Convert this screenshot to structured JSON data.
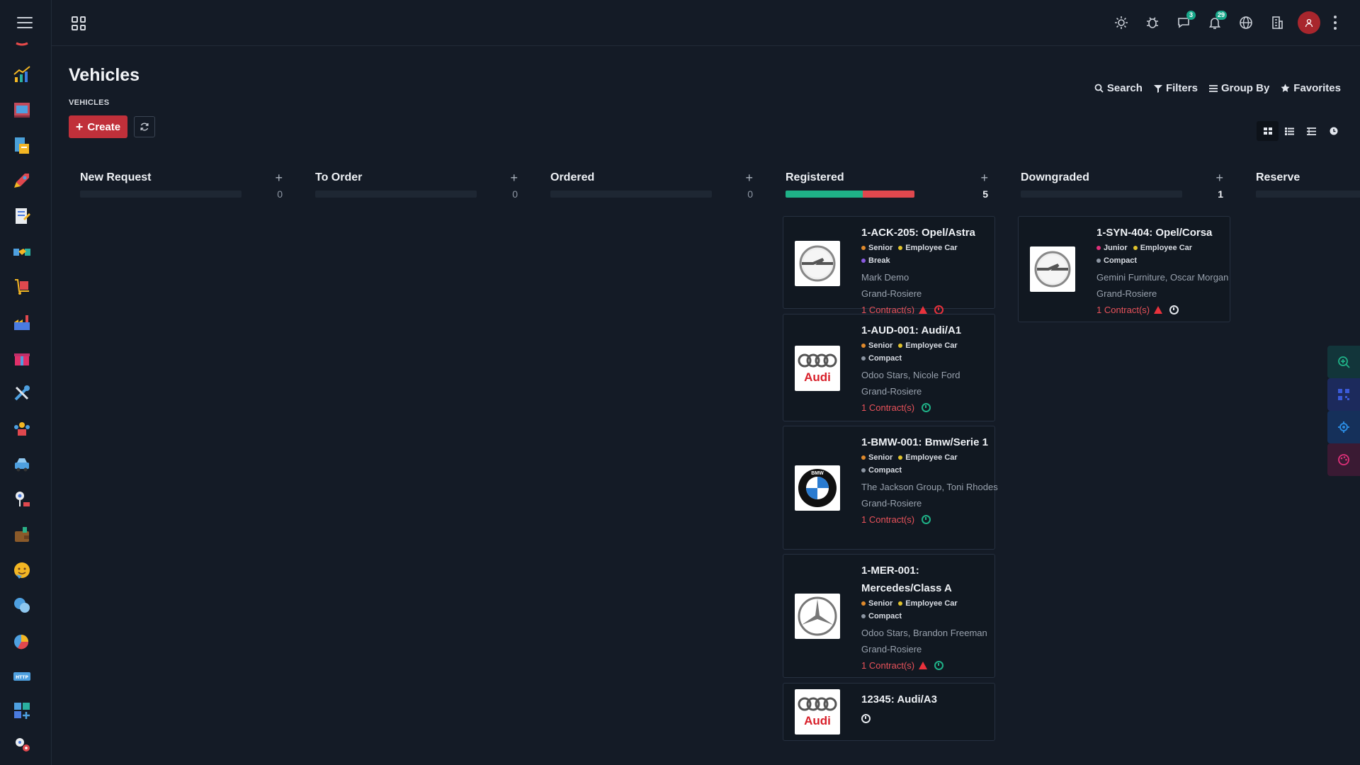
{
  "colors": {
    "background": "#141b26",
    "accent_red": "#c0303a",
    "green": "#1fb187",
    "red": "#e0484e",
    "tag_senior": "#e08a2c",
    "tag_employee_car": "#e0c22c",
    "tag_break": "#8a5ae0",
    "tag_compact": "#8d96a3",
    "tag_junior": "#e0307a"
  },
  "topbar": {
    "icons": [
      "apps-grid-icon",
      "sun-icon",
      "bug-icon",
      "chat-icon",
      "bell-icon",
      "globe-icon",
      "building-icon",
      "avatar",
      "kebab-icon"
    ],
    "chat_badge": "3",
    "bell_badge": "29"
  },
  "sidebar": {
    "icons": [
      "menu-icon",
      "sales-chart-icon",
      "store-icon",
      "inventory-icon",
      "rocket-icon",
      "notes-icon",
      "handshake-icon",
      "delivery-icon",
      "factory-icon",
      "gift-icon",
      "tools-icon",
      "team-icon",
      "car-icon",
      "map-pin-icon",
      "wallet-icon",
      "smiley-icon",
      "chat-bubbles-icon",
      "pie-chart-icon",
      "http-icon",
      "apps-plus-icon",
      "gears-icon"
    ]
  },
  "page": {
    "title": "Vehicles",
    "breadcrumb": "VEHICLES",
    "create_label": "Create"
  },
  "search": {
    "search_label": "Search",
    "filters_label": "Filters",
    "groupby_label": "Group By",
    "favorites_label": "Favorites"
  },
  "columns": [
    {
      "title": "New Request",
      "count": "0"
    },
    {
      "title": "To Order",
      "count": "0"
    },
    {
      "title": "Ordered",
      "count": "0"
    },
    {
      "title": "Registered",
      "count": "5",
      "progress": {
        "green": 0.6,
        "red": 0.4
      }
    },
    {
      "title": "Downgraded",
      "count": "1"
    },
    {
      "title": "Reserve",
      "count": ""
    }
  ],
  "cards": {
    "registered": [
      {
        "name": "1-ACK-205: Opel/Astra",
        "tags": [
          "Senior",
          "Employee Car",
          "Break"
        ],
        "driver": "Mark Demo",
        "location": "Grand-Rosiere",
        "contracts": "1 Contract(s)",
        "logo": "opel-logo"
      },
      {
        "name": "1-AUD-001: Audi/A1",
        "tags": [
          "Senior",
          "Employee Car",
          "Compact"
        ],
        "driver": "Odoo Stars, Nicole Ford",
        "location": "Grand-Rosiere",
        "contracts": "1 Contract(s)",
        "logo": "audi-logo",
        "logo_text": "Audi"
      },
      {
        "name": "1-BMW-001: Bmw/Serie 1",
        "tags": [
          "Senior",
          "Employee Car",
          "Compact"
        ],
        "driver": "The Jackson Group, Toni Rhodes",
        "location": "Grand-Rosiere",
        "contracts": "1 Contract(s)",
        "logo": "bmw-logo",
        "logo_text": "BMW"
      },
      {
        "name": "1-MER-001: Mercedes/Class A",
        "tags": [
          "Senior",
          "Employee Car",
          "Compact"
        ],
        "driver": "Odoo Stars, Brandon Freeman",
        "location": "Grand-Rosiere",
        "contracts": "1 Contract(s)",
        "logo": "mercedes-logo"
      },
      {
        "name": "12345: Audi/A3",
        "tags": [],
        "logo": "audi-logo",
        "logo_text": "Audi"
      }
    ],
    "downgraded": [
      {
        "name": "1-SYN-404: Opel/Corsa",
        "tags": [
          "Junior",
          "Employee Car",
          "Compact"
        ],
        "driver": "Gemini Furniture, Oscar Morgan",
        "location": "Grand-Rosiere",
        "contracts": "1 Contract(s)",
        "logo": "opel-logo"
      }
    ]
  },
  "float_tools": [
    "zoom-in-icon",
    "qr-icon",
    "settings-icon",
    "palette-icon"
  ]
}
